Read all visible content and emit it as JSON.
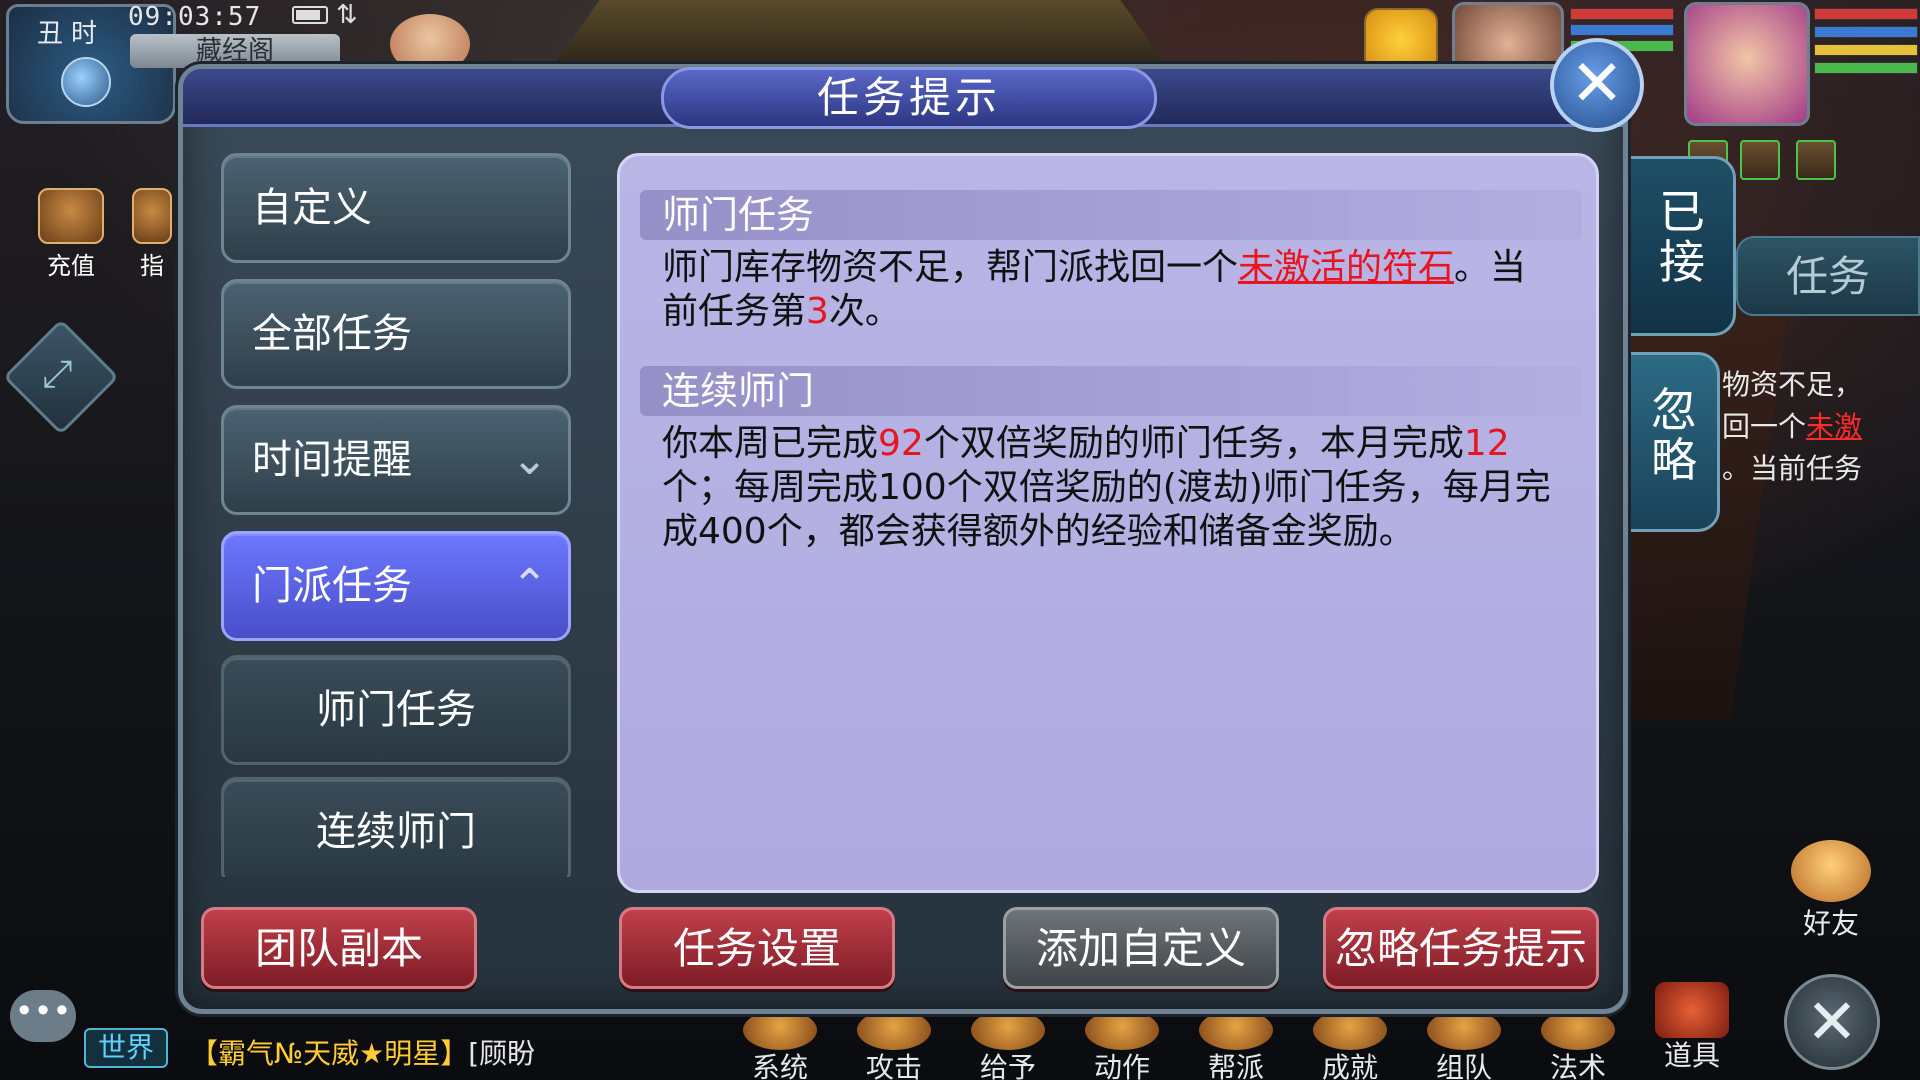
{
  "hud": {
    "shichen": "丑时",
    "time": "09:03:57",
    "signal": "⇅",
    "location": "藏经阁",
    "recharge_label": "充值",
    "guide_label": "指",
    "expand_icon": "⤢"
  },
  "dialog": {
    "title": "任务提示",
    "close_glyph": "✕",
    "menu": [
      {
        "label": "自定义"
      },
      {
        "label": "全部任务"
      },
      {
        "label": "时间提醒",
        "chevron": "⌄"
      },
      {
        "label": "门派任务",
        "chevron": "⌃"
      },
      {
        "label": "师门任务"
      },
      {
        "label": "连续师门"
      }
    ],
    "sections": [
      {
        "title": "师门任务",
        "text_1": "师门库存物资不足，帮门派找回一个",
        "link": "未激活的符石",
        "text_2": "。当前任务第",
        "count": "3",
        "text_3": "次。"
      },
      {
        "title": "连续师门",
        "text_1": "你本周已完成",
        "week_count": "92",
        "text_2": "个双倍奖励的师门任务，本月完成",
        "month_count": "12",
        "text_3": "个；每周完成100个双倍奖励的(渡劫)师门任务，每月完成400个，都会获得额外的经验和储备金奖励。"
      }
    ],
    "buttons": {
      "team_dungeon": "团队副本",
      "task_settings": "任务设置",
      "add_custom": "添加自定义",
      "ignore_tip": "忽略任务提示"
    }
  },
  "side_tabs": {
    "accepted": "已\n接",
    "ignored": "忽\n略"
  },
  "right_panel": {
    "tab_label": "任务",
    "line1": "物资不足，",
    "line2_prefix": "回一个",
    "line2_link": "未激",
    "line3": "。当前任务"
  },
  "friend_label": "好友",
  "close_glyph": "✕",
  "chat": {
    "icon": "•••",
    "channel": "世界",
    "sender": "【霸气№天威★明星】",
    "message": "[顾盼"
  },
  "bottom_menu": [
    "系统",
    "攻击",
    "给予",
    "动作",
    "帮派",
    "成就",
    "组队",
    "法术",
    "道具"
  ]
}
